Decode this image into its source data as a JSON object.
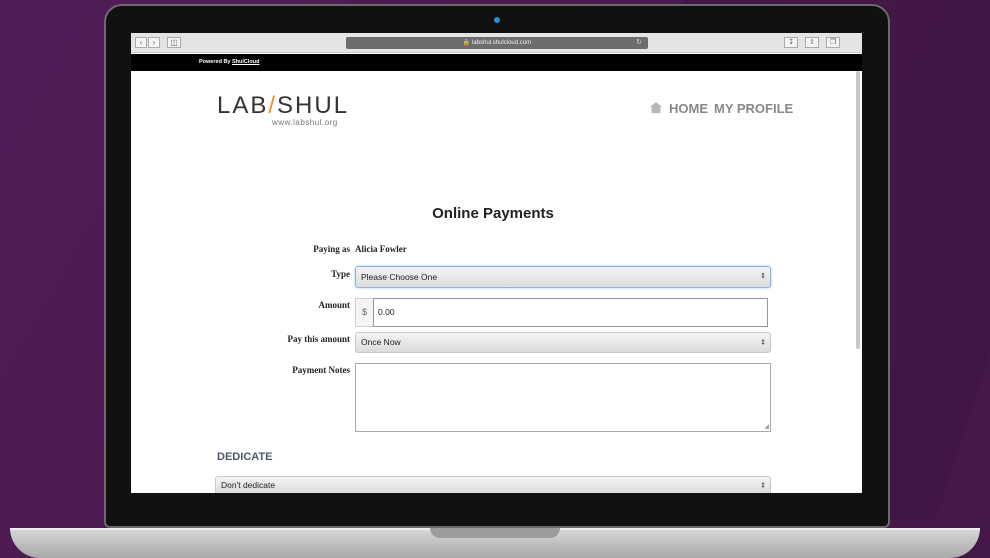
{
  "browser": {
    "url": "labshul.shulcloud.com"
  },
  "powered_bar": {
    "prefix": "Powered By",
    "link": "ShulCloud"
  },
  "site": {
    "logo_left": "LAB",
    "logo_slash": "/",
    "logo_right": "SHUL",
    "logo_sub": "www.labshul.org",
    "nav": {
      "home": "HOME",
      "profile": "MY PROFILE"
    }
  },
  "form": {
    "title": "Online Payments",
    "paying_as_label": "Paying as",
    "paying_as_value": "Alicia Fowler",
    "type_label": "Type",
    "type_value": "Please Choose One",
    "amount_label": "Amount",
    "currency": "$",
    "amount_value": "0.00",
    "frequency_label": "Pay this amount",
    "frequency_value": "Once Now",
    "notes_label": "Payment Notes",
    "notes_value": ""
  },
  "dedicate": {
    "heading": "DEDICATE",
    "select_value": "Don't dedicate"
  },
  "colors": {
    "background": "#4a1a4f",
    "logo_accent": "#f28c28",
    "nav_text": "#888888"
  },
  "icons": {
    "back": "chevron-left-icon",
    "forward": "chevron-right-icon",
    "sidebar": "sidebar-icon",
    "lock": "lock-icon",
    "reload": "reload-icon",
    "download": "download-icon",
    "share": "share-icon",
    "tabs": "tabs-icon",
    "home": "home-icon",
    "select_arrow": "updown-arrow-icon"
  }
}
